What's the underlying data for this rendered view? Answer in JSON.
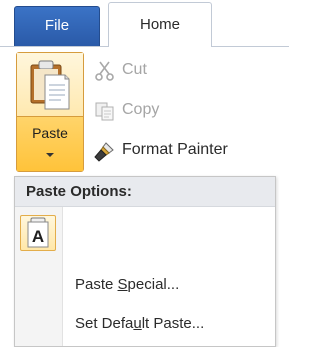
{
  "tabs": {
    "file": "File",
    "home": "Home"
  },
  "clipboard": {
    "paste_label": "Paste",
    "cut_label": "Cut",
    "copy_label": "Copy",
    "format_painter_label": "Format Painter"
  },
  "paste_menu": {
    "header": "Paste Options:",
    "option_a": "A",
    "paste_special": {
      "before": "Paste ",
      "accel": "S",
      "after": "pecial..."
    },
    "set_default": {
      "before": "Set Defa",
      "accel": "u",
      "after": "lt Paste..."
    }
  },
  "colors": {
    "file_tab": "#2a5aa8",
    "paste_highlight": "#ffc33a",
    "disabled_text": "#a5a5a5"
  }
}
